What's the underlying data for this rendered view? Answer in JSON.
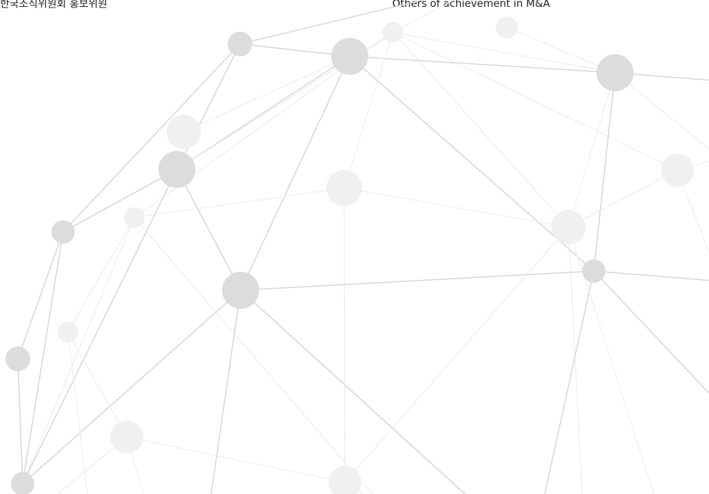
{
  "captions": {
    "left": "한국조직위원회 홍보위원",
    "right": "Others of achievement in M&A"
  },
  "colors": {
    "background": "#ffffff",
    "node_dark": "#dcdcdc",
    "node_light": "#f0f0f0",
    "edge_dark": "#d6d6d6",
    "edge_light": "#ececec",
    "text": "#1f1f1f"
  }
}
